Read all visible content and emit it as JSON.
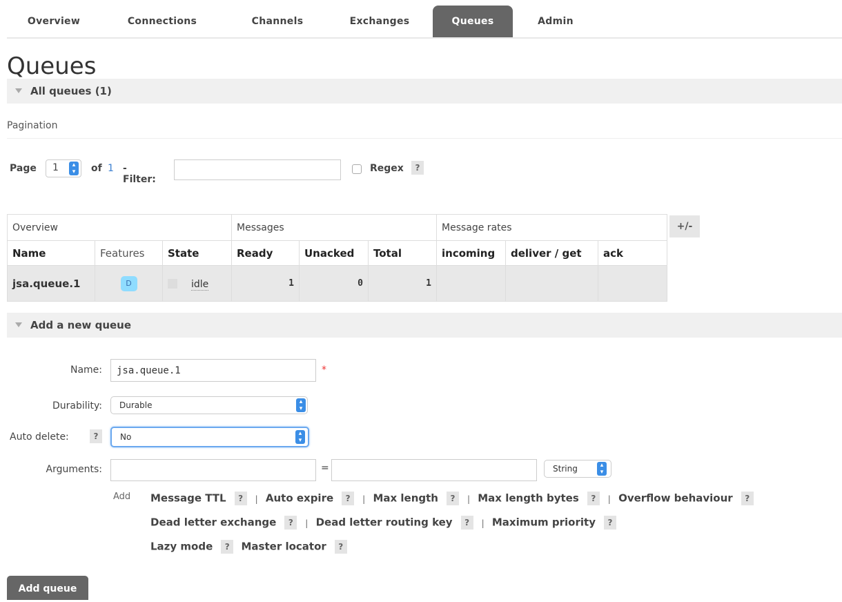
{
  "nav": {
    "tabs": [
      "Overview",
      "Connections",
      "Channels",
      "Exchanges",
      "Queues",
      "Admin"
    ],
    "active": "Queues"
  },
  "page_title": "Queues",
  "all_queues": {
    "label": "All queues (1)"
  },
  "pagination": {
    "section_label": "Pagination",
    "page_label": "Page",
    "page_value": "1",
    "of_label": "of",
    "total_pages": "1",
    "filter_label": "- Filter:",
    "filter_value": "",
    "regex_label": "Regex",
    "help": "?"
  },
  "table": {
    "groups": [
      "Overview",
      "Messages",
      "Message rates"
    ],
    "columns": [
      "Name",
      "Features",
      "State",
      "Ready",
      "Unacked",
      "Total",
      "incoming",
      "deliver / get",
      "ack"
    ],
    "rows": [
      {
        "name": "jsa.queue.1",
        "feature": "D",
        "state": "idle",
        "ready": "1",
        "unacked": "0",
        "total": "1",
        "incoming": "",
        "deliver_get": "",
        "ack": ""
      }
    ],
    "plusminus": "+/-"
  },
  "add_queue": {
    "section_label": "Add a new queue",
    "name_label": "Name:",
    "name_value": "jsa.queue.1",
    "required_mark": "*",
    "durability_label": "Durability:",
    "durability_value": "Durable",
    "auto_delete_label": "Auto delete:",
    "auto_delete_value": "No",
    "arguments_label": "Arguments:",
    "equals": "=",
    "arg_type": "String",
    "add_label": "Add",
    "arg_links": [
      [
        "Message TTL",
        "Auto expire",
        "Max length",
        "Max length bytes",
        "Overflow behaviour"
      ],
      [
        "Dead letter exchange",
        "Dead letter routing key",
        "Maximum priority"
      ],
      [
        "Lazy mode",
        "Master locator"
      ]
    ],
    "separator": "|",
    "help": "?",
    "submit_label": "Add queue"
  },
  "colors": {
    "accent": "#666666",
    "stepper": "#3b8ee6",
    "feature_badge": "#8fdcff",
    "required": "#ee3333"
  }
}
